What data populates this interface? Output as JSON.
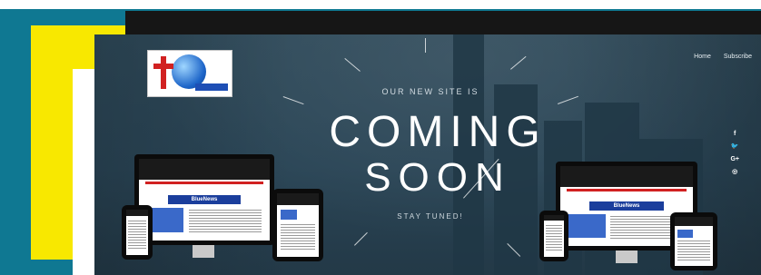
{
  "nav": {
    "home": "Home",
    "subscribe": "Subscribe"
  },
  "hero": {
    "kicker": "OUR NEW SITE IS",
    "headline_line1": "COMING",
    "headline_line2": "SOON",
    "tagline": "STAY TUNED!"
  },
  "social": [
    {
      "icon": "facebook-icon",
      "glyph": "f"
    },
    {
      "icon": "twitter-icon",
      "glyph": "🐦"
    },
    {
      "icon": "google-plus-icon",
      "glyph": "G+"
    },
    {
      "icon": "instagram-icon",
      "glyph": "◎"
    }
  ],
  "devices": {
    "brand_text": "BlueNews"
  },
  "colors": {
    "frame_teal": "#0f7892",
    "accent_yellow": "#f8e800",
    "top_bar": "#161616",
    "hero_bg": "#2a4556"
  }
}
